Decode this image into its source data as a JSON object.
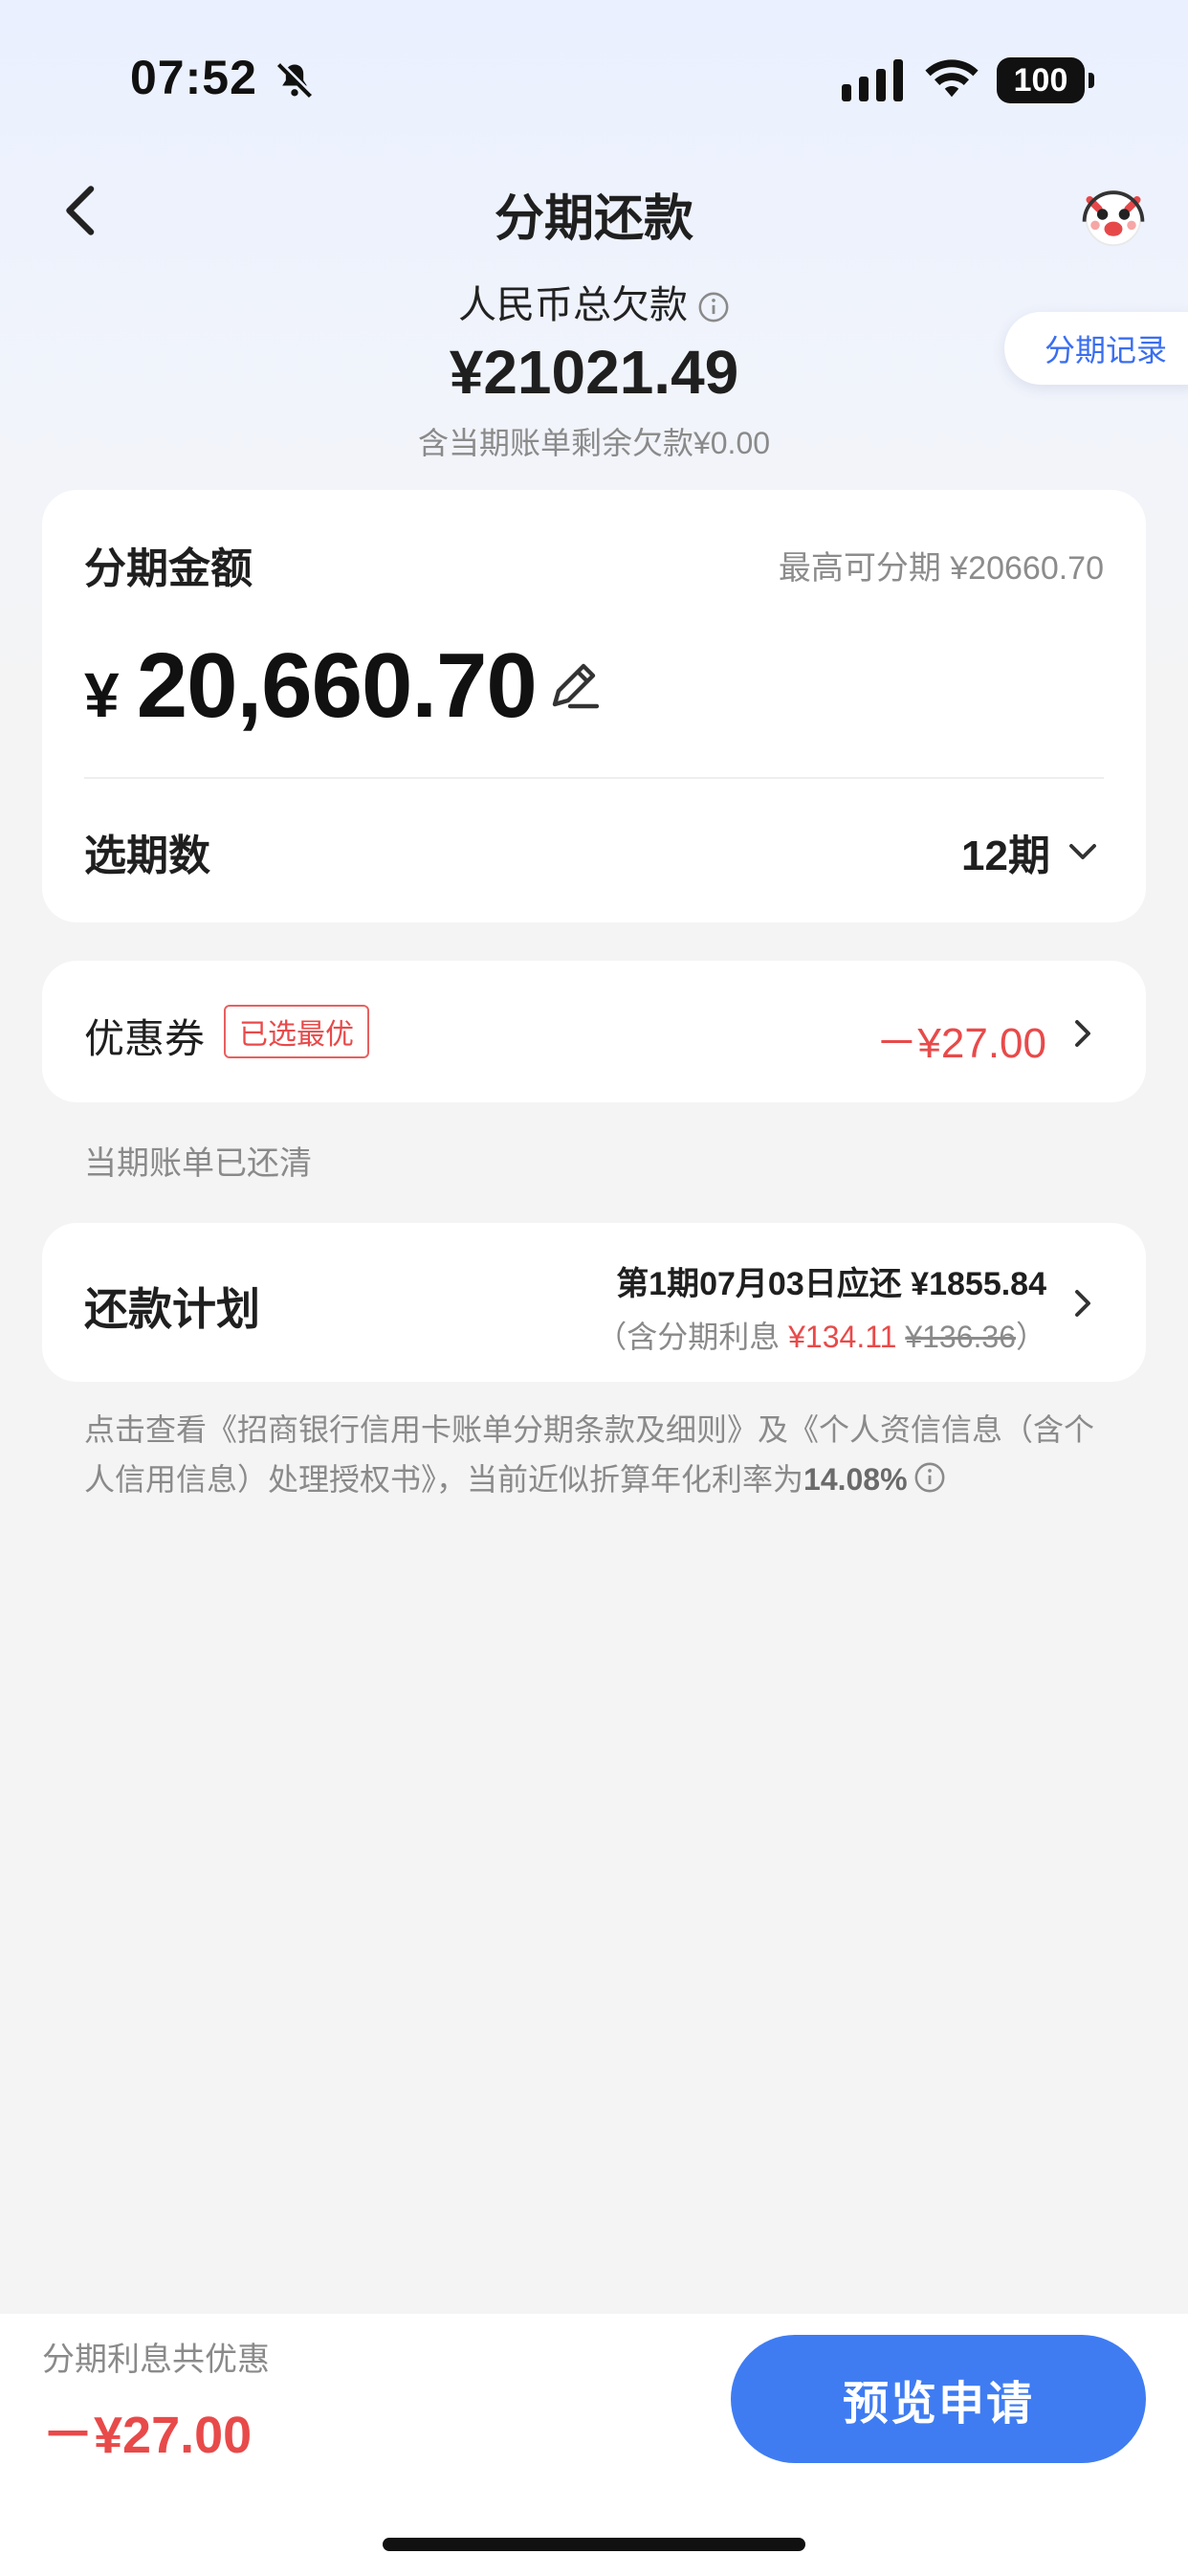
{
  "status_bar": {
    "time": "07:52",
    "battery": "100"
  },
  "nav": {
    "title": "分期还款"
  },
  "debt": {
    "label": "人民币总欠款",
    "amount": "¥21021.49",
    "sub": "含当期账单剩余欠款¥0.00"
  },
  "record_button": "分期记录",
  "installment": {
    "label": "分期金额",
    "max": "最高可分期 ¥20660.70",
    "currency": "¥",
    "amount": "20,660.70",
    "period_label": "选期数",
    "period_value": "12期"
  },
  "coupon": {
    "label": "优惠券",
    "tag": "已选最优",
    "discount": "－¥27.00"
  },
  "cleared_note": "当期账单已还清",
  "plan": {
    "label": "还款计划",
    "line1": "第1期07月03日应还 ¥1855.84",
    "interest_prefix": "（含分期利息 ",
    "interest_now": "¥134.11",
    "interest_old": "¥136.36",
    "interest_suffix": "）"
  },
  "terms": {
    "text": "点击查看《招商银行信用卡账单分期条款及细则》及《个人资信信息（含个人信用信息）处理授权书》，当前近似折算年化利率为",
    "rate": "14.08%"
  },
  "bottom": {
    "label": "分期利息共优惠",
    "value": "－¥27.00",
    "apply_button": "预览申请"
  },
  "colors": {
    "accent": "#3f7cf2",
    "discount": "#e84a4a"
  }
}
